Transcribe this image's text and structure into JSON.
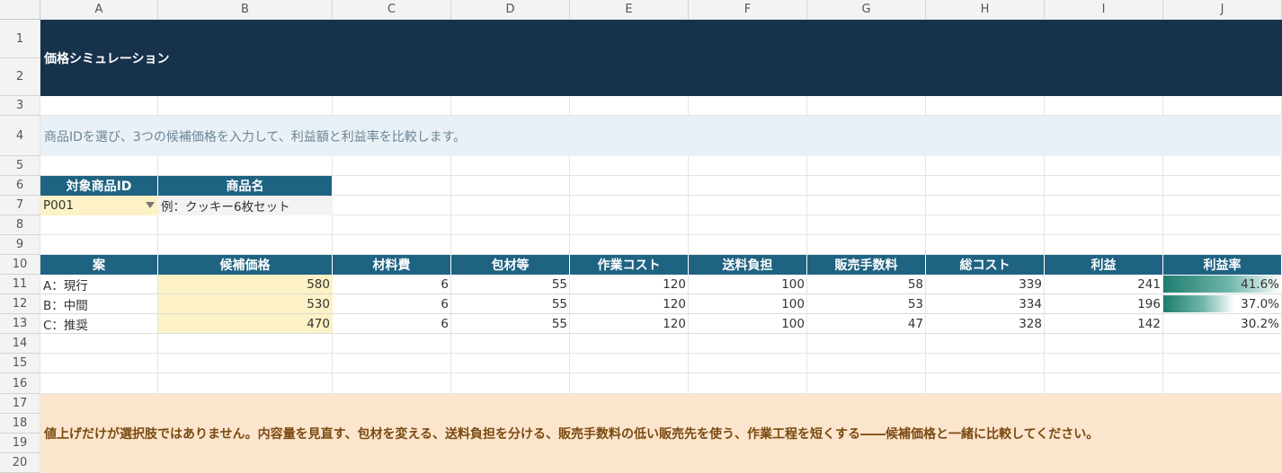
{
  "sheet": {
    "columns": [
      "A",
      "B",
      "C",
      "D",
      "E",
      "F",
      "G",
      "H",
      "I",
      "J"
    ],
    "rows": [
      "1",
      "2",
      "3",
      "4",
      "5",
      "6",
      "7",
      "8",
      "9",
      "10",
      "11",
      "12",
      "13",
      "14",
      "15",
      "16",
      "17",
      "18",
      "19",
      "20"
    ]
  },
  "banner": {
    "title": "価格シミュレーション"
  },
  "instruction": "商品IDを選び、3つの候補価格を入力して、利益額と利益率を比較します。",
  "product": {
    "id_header": "対象商品ID",
    "name_header": "商品名",
    "id_value": "P001",
    "name_value": "例：クッキー6枚セット"
  },
  "table": {
    "headers": [
      "案",
      "候補価格",
      "材料費",
      "包材等",
      "作業コスト",
      "送料負担",
      "販売手数料",
      "総コスト",
      "利益",
      "利益率"
    ],
    "rows": [
      {
        "plan": "A：現行",
        "price": "580",
        "material": "6",
        "packaging": "55",
        "labor": "120",
        "shipping": "100",
        "fee": "58",
        "total": "339",
        "profit": "241",
        "margin": "41.6%",
        "margin_value": 0.416
      },
      {
        "plan": "B：中間",
        "price": "530",
        "material": "6",
        "packaging": "55",
        "labor": "120",
        "shipping": "100",
        "fee": "53",
        "total": "334",
        "profit": "196",
        "margin": "37.0%",
        "margin_value": 0.37
      },
      {
        "plan": "C：推奨",
        "price": "470",
        "material": "6",
        "packaging": "55",
        "labor": "120",
        "shipping": "100",
        "fee": "47",
        "total": "328",
        "profit": "142",
        "margin": "30.2%",
        "margin_value": 0.302
      }
    ]
  },
  "note": "値上げだけが選択肢ではありません。内容量を見直す、包材を変える、送料負担を分ける、販売手数料の低い販売先を使う、作業工程を短くする――候補価格と一緒に比較してください。",
  "colors": {
    "banner": "#17324b",
    "header": "#1f6382",
    "input": "#fdf2c5",
    "note": "#fce5cd",
    "bar": "#1e7d6f"
  }
}
